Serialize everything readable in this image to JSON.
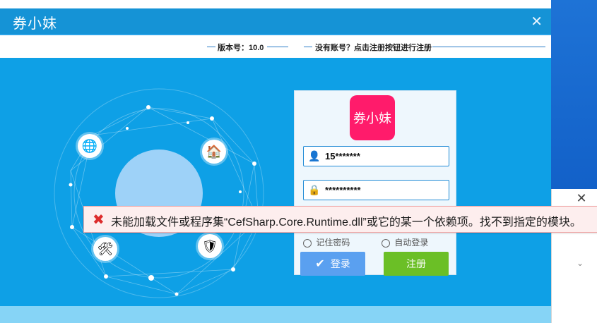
{
  "app": {
    "title": "券小妹",
    "close_icon": "close-icon",
    "version_text": "版本号：10.0",
    "signup_hint": "没有账号？点击注册按钮进行注册"
  },
  "login": {
    "logo_text": "券小妹",
    "username_value": "15*******",
    "password_value": "**********",
    "option_remember": "记住密码",
    "option_auto": "自动登录",
    "login_label": "登录",
    "register_label": "注册",
    "user_icon": "user-icon",
    "lock_icon": "lock-icon",
    "check_icon": "check-icon"
  },
  "error": {
    "message": "未能加载文件或程序集“CefSharp.Core.Runtime.dll”或它的某一个依赖项。找不到指定的模块。",
    "icon": "error-x-icon"
  },
  "background_window": {
    "close_icon": "close-icon"
  },
  "colors": {
    "primary_blue": "#1196e0",
    "logo_pink": "#ff1b6b",
    "login_button": "#5aa0f0",
    "register_button": "#6bbf26",
    "error_bg": "#fdeeee",
    "error_icon": "#dd2c2c"
  }
}
